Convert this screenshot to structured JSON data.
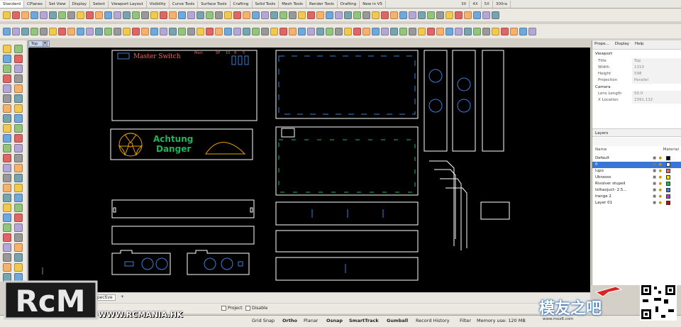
{
  "top_tabs": [
    "Standard",
    "CPlanes",
    "Set View",
    "Display",
    "Select",
    "Viewport Layout",
    "Visibility",
    "Curve Tools",
    "Surface Tools",
    "Crafting",
    "Solid Tools",
    "Mesh Tools",
    "Render Tools",
    "Drafting",
    "New in V5"
  ],
  "right_tabs": [
    "3X",
    "4X",
    "5X",
    "300ra"
  ],
  "viewport": {
    "name": "Top"
  },
  "properties": {
    "tabs": [
      "Prope...",
      "Display",
      "Help"
    ],
    "section": "Viewport",
    "rows": [
      {
        "k": "Title",
        "v": "Top"
      },
      {
        "k": "Width",
        "v": "1310"
      },
      {
        "k": "Height",
        "v": "598"
      },
      {
        "k": "Projection",
        "v": "Parallel"
      }
    ],
    "camera_section": "Camera",
    "camera_rows": [
      {
        "k": "Lens Length",
        "v": "50.0"
      },
      {
        "k": "X Location",
        "v": "2391.132"
      }
    ]
  },
  "layers": {
    "title": "Layers",
    "col_name": "Name",
    "col_material": "Material",
    "items": [
      {
        "name": "Default",
        "color": "#000000"
      },
      {
        "name": "0",
        "color": "#ffffff"
      },
      {
        "name": "lupo",
        "color": "#ff6b6b"
      },
      {
        "name": "Ubrasso",
        "color": "#e8e800"
      },
      {
        "name": "Rivolver stupeil",
        "color": "#1fb35a"
      },
      {
        "name": "Isthaxjuct- 2.5...",
        "color": "#3a7fd5"
      },
      {
        "name": "Irange 2",
        "color": "#b23ccf"
      },
      {
        "name": "Layer 01",
        "color": "#d60000"
      }
    ]
  },
  "bottom_tabs": [
    "Perspective",
    "+"
  ],
  "osnap": {
    "project": "Project",
    "disable": "Disable"
  },
  "status": {
    "grid_snap": "Grid Snap",
    "ortho": "Ortho",
    "planar": "Planar",
    "osnap": "Osnap",
    "smarttrack": "SmartTrack",
    "gumball": "Gumball",
    "record": "Record History",
    "filter": "Filter",
    "memory": "Memory use: 120 MB"
  },
  "drawing": {
    "master_switch": "Master Switch",
    "achtung": "Achtung",
    "danger": "Danger",
    "red_labels": [
      "Main",
      "SP",
      "10",
      "8",
      "5"
    ]
  },
  "watermark": {
    "rcm_text": "RcM",
    "rcm_url": "WWW.RCMANIA.HK",
    "moz": "模友之吧",
    "moz_url": "www.moz8.com"
  },
  "colors": {
    "viewport_bg": "#000000",
    "selected_layer": "#3875d7"
  }
}
